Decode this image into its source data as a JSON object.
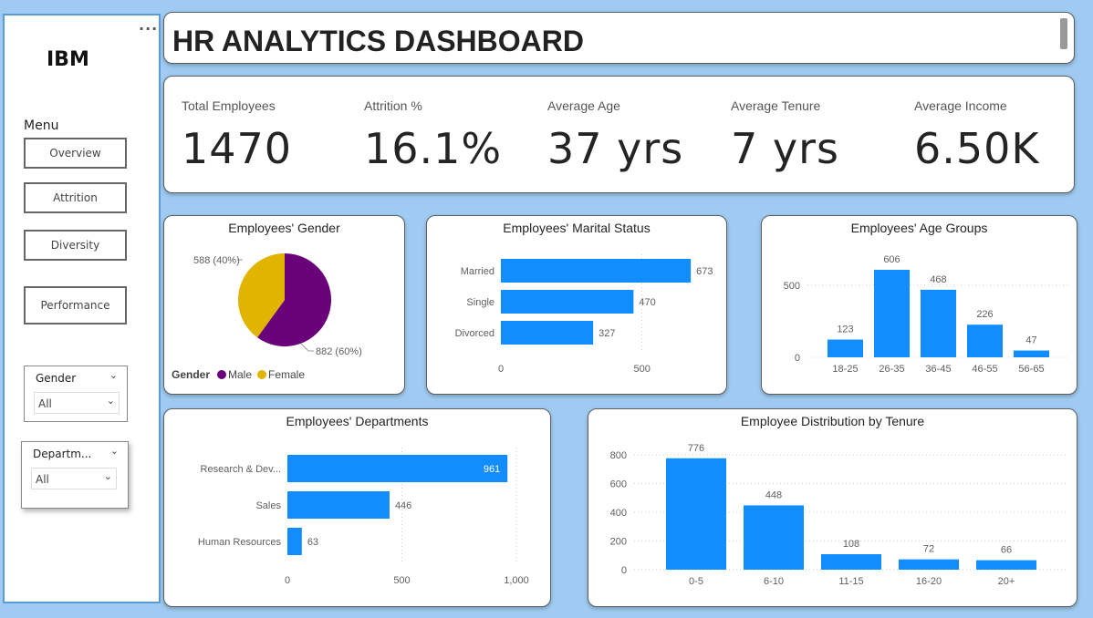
{
  "sidebar": {
    "brand": "IBM",
    "menu_label": "Menu",
    "nav": [
      "Overview",
      "Attrition",
      "Diversity",
      "Performance"
    ],
    "slicers": [
      {
        "title": "Gender",
        "value": "All"
      },
      {
        "title": "Departm...",
        "value": "All"
      }
    ]
  },
  "header": {
    "title": "HR ANALYTICS DASHBOARD"
  },
  "kpis": [
    {
      "label": "Total Employees",
      "value": "1470"
    },
    {
      "label": "Attrition %",
      "value": "16.1%"
    },
    {
      "label": "Average Age",
      "value": "37 yrs"
    },
    {
      "label": "Average Tenure",
      "value": "7 yrs"
    },
    {
      "label": "Average Income",
      "value": "6.50K"
    }
  ],
  "colors": {
    "bar": "#118dff",
    "male": "#6b007b",
    "female": "#e0b400"
  },
  "chart_data": [
    {
      "type": "pie",
      "title": "Employees' Gender",
      "legend_title": "Gender",
      "categories": [
        "Male",
        "Female"
      ],
      "values": [
        882,
        588
      ],
      "labels": [
        "882 (60%)",
        "588 (40%)"
      ]
    },
    {
      "type": "bar",
      "orientation": "horizontal",
      "title": "Employees' Marital Status",
      "categories": [
        "Married",
        "Single",
        "Divorced"
      ],
      "values": [
        673,
        470,
        327
      ],
      "xticks": [
        "0",
        "500"
      ],
      "xlim": [
        0,
        700
      ]
    },
    {
      "type": "bar",
      "title": "Employees' Age Groups",
      "categories": [
        "18-25",
        "26-35",
        "36-45",
        "46-55",
        "56-65"
      ],
      "values": [
        123,
        606,
        468,
        226,
        47
      ],
      "yticks": [
        "0",
        "500"
      ],
      "ylim": [
        0,
        606
      ]
    },
    {
      "type": "bar",
      "orientation": "horizontal",
      "title": "Employees' Departments",
      "categories": [
        "Research & Dev...",
        "Sales",
        "Human Resources"
      ],
      "values": [
        961,
        446,
        63
      ],
      "xticks": [
        "0",
        "500",
        "1,000"
      ],
      "xlim": [
        0,
        1000
      ]
    },
    {
      "type": "bar",
      "title": "Employee Distribution by Tenure",
      "categories": [
        "0-5",
        "6-10",
        "11-15",
        "16-20",
        "20+"
      ],
      "values": [
        776,
        448,
        108,
        72,
        66
      ],
      "yticks": [
        "0",
        "200",
        "400",
        "600",
        "800"
      ],
      "ylim": [
        0,
        800
      ]
    }
  ]
}
